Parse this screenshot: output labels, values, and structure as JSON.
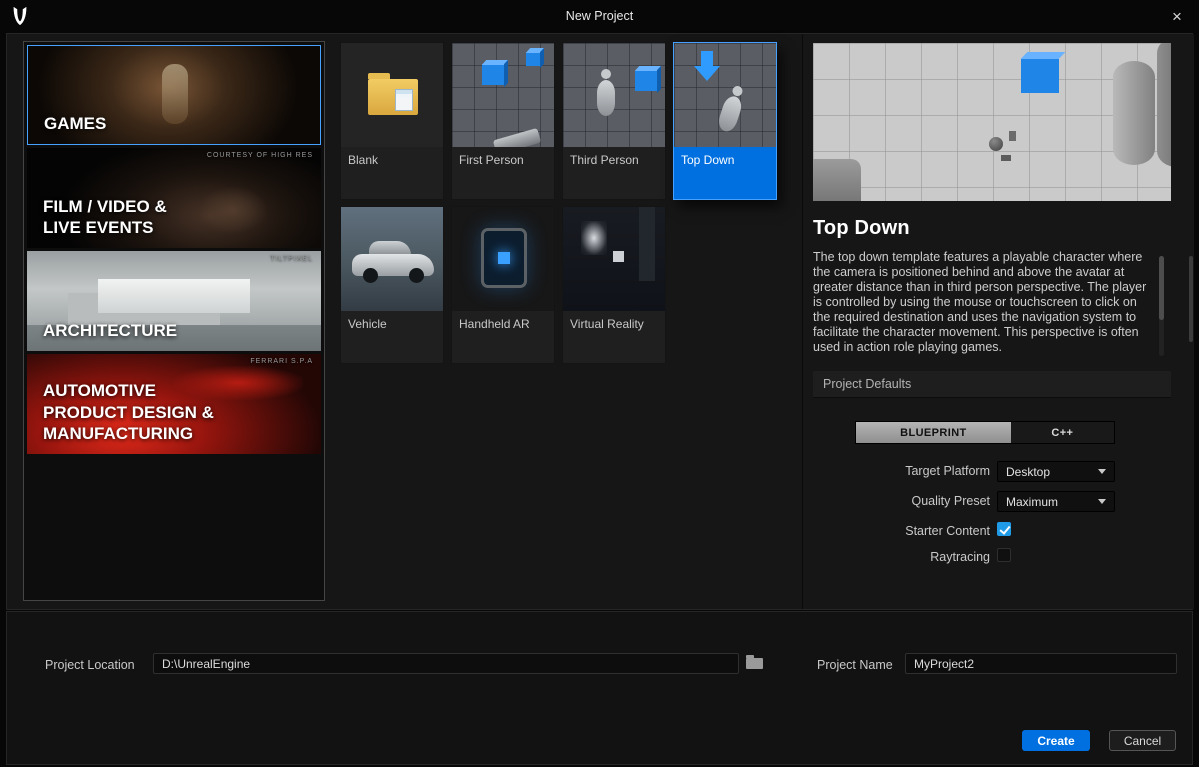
{
  "accent_color": "#0070e0",
  "titlebar": {
    "title": "New Project",
    "close_label": "×"
  },
  "categories": {
    "items": [
      {
        "label": "GAMES",
        "badge": "",
        "selected": true
      },
      {
        "label": "FILM / VIDEO &\nLIVE EVENTS",
        "badge": "COURTESY OF HIGH RES",
        "selected": false
      },
      {
        "label": "ARCHITECTURE",
        "badge": "TILTPIXEL",
        "selected": false
      },
      {
        "label": "AUTOMOTIVE\nPRODUCT DESIGN &\nMANUFACTURING",
        "badge": "FERRARI S.P.A",
        "selected": false
      }
    ]
  },
  "templates": {
    "items": [
      {
        "label": "Blank",
        "icon": "folder-icon",
        "selected": false
      },
      {
        "label": "First Person",
        "icon": "first-person-thumbnail",
        "selected": false
      },
      {
        "label": "Third Person",
        "icon": "third-person-thumbnail",
        "selected": false
      },
      {
        "label": "Top Down",
        "icon": "top-down-thumbnail",
        "selected": true
      },
      {
        "label": "Vehicle",
        "icon": "vehicle-thumbnail",
        "selected": false
      },
      {
        "label": "Handheld AR",
        "icon": "handheld-ar-thumbnail",
        "selected": false
      },
      {
        "label": "Virtual Reality",
        "icon": "virtual-reality-thumbnail",
        "selected": false
      }
    ]
  },
  "detail": {
    "title": "Top Down",
    "description": "The top down template features a playable character where the camera is positioned behind and above the avatar at greater distance than in third person perspective. The player is controlled by using the mouse or touchscreen to click on the required destination and uses the navigation system to facilitate the character movement. This perspective is often used in action role playing games.",
    "section_label": "Project Defaults",
    "language_toggle": {
      "blueprint": "BLUEPRINT",
      "cpp": "C++",
      "selected": "BLUEPRINT"
    },
    "fields": {
      "target_platform": {
        "label": "Target Platform",
        "value": "Desktop"
      },
      "quality_preset": {
        "label": "Quality Preset",
        "value": "Maximum"
      },
      "starter_content": {
        "label": "Starter Content",
        "checked": true
      },
      "raytracing": {
        "label": "Raytracing",
        "checked": false
      }
    }
  },
  "footer": {
    "project_location": {
      "label": "Project Location",
      "value": "D:\\UnrealEngine"
    },
    "project_name": {
      "label": "Project Name",
      "value": "MyProject2"
    },
    "create_label": "Create",
    "cancel_label": "Cancel"
  }
}
